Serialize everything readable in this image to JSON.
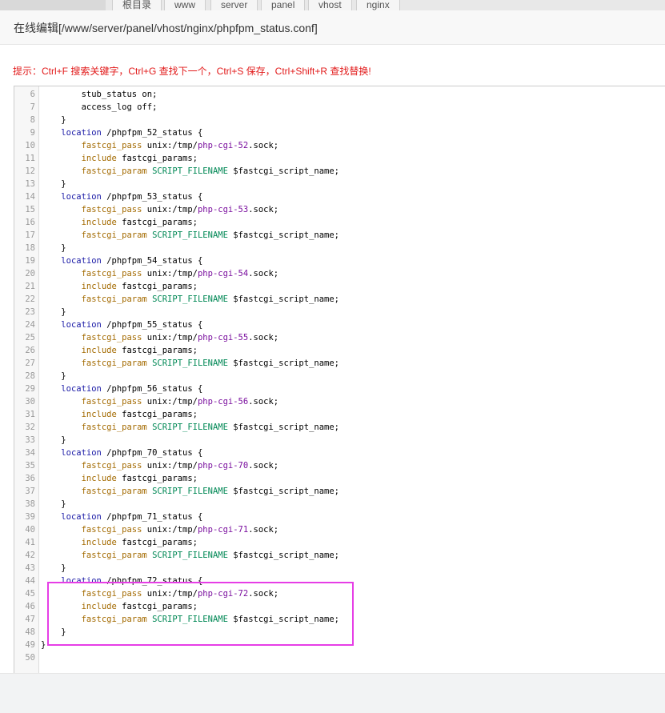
{
  "breadcrumb": [
    "根目录",
    "www",
    "server",
    "panel",
    "vhost",
    "nginx"
  ],
  "dialog": {
    "title": "在线编辑[/www/server/panel/vhost/nginx/phpfpm_status.conf]",
    "hint": "提示：Ctrl+F 搜索关键字，Ctrl+G 查找下一个，Ctrl+S 保存，Ctrl+Shift+R 查找替换!"
  },
  "editor": {
    "first_line": 6,
    "lines": [
      "        stub_status on;",
      "        access_log off;",
      "    }",
      "    location /phpfpm_52_status {",
      "        fastcgi_pass unix:/tmp/php-cgi-52.sock;",
      "        include fastcgi_params;",
      "        fastcgi_param SCRIPT_FILENAME $fastcgi_script_name;",
      "    }",
      "    location /phpfpm_53_status {",
      "        fastcgi_pass unix:/tmp/php-cgi-53.sock;",
      "        include fastcgi_params;",
      "        fastcgi_param SCRIPT_FILENAME $fastcgi_script_name;",
      "    }",
      "    location /phpfpm_54_status {",
      "        fastcgi_pass unix:/tmp/php-cgi-54.sock;",
      "        include fastcgi_params;",
      "        fastcgi_param SCRIPT_FILENAME $fastcgi_script_name;",
      "    }",
      "    location /phpfpm_55_status {",
      "        fastcgi_pass unix:/tmp/php-cgi-55.sock;",
      "        include fastcgi_params;",
      "        fastcgi_param SCRIPT_FILENAME $fastcgi_script_name;",
      "    }",
      "    location /phpfpm_56_status {",
      "        fastcgi_pass unix:/tmp/php-cgi-56.sock;",
      "        include fastcgi_params;",
      "        fastcgi_param SCRIPT_FILENAME $fastcgi_script_name;",
      "    }",
      "    location /phpfpm_70_status {",
      "        fastcgi_pass unix:/tmp/php-cgi-70.sock;",
      "        include fastcgi_params;",
      "        fastcgi_param SCRIPT_FILENAME $fastcgi_script_name;",
      "    }",
      "    location /phpfpm_71_status {",
      "        fastcgi_pass unix:/tmp/php-cgi-71.sock;",
      "        include fastcgi_params;",
      "        fastcgi_param SCRIPT_FILENAME $fastcgi_script_name;",
      "    }",
      "    location /phpfpm_72_status {",
      "        fastcgi_pass unix:/tmp/php-cgi-72.sock;",
      "        include fastcgi_params;",
      "        fastcgi_param SCRIPT_FILENAME $fastcgi_script_name;",
      "    }",
      "}",
      ""
    ]
  },
  "colors": {
    "hint": "#e21b1b",
    "highlight_box": "#e63ee6"
  }
}
